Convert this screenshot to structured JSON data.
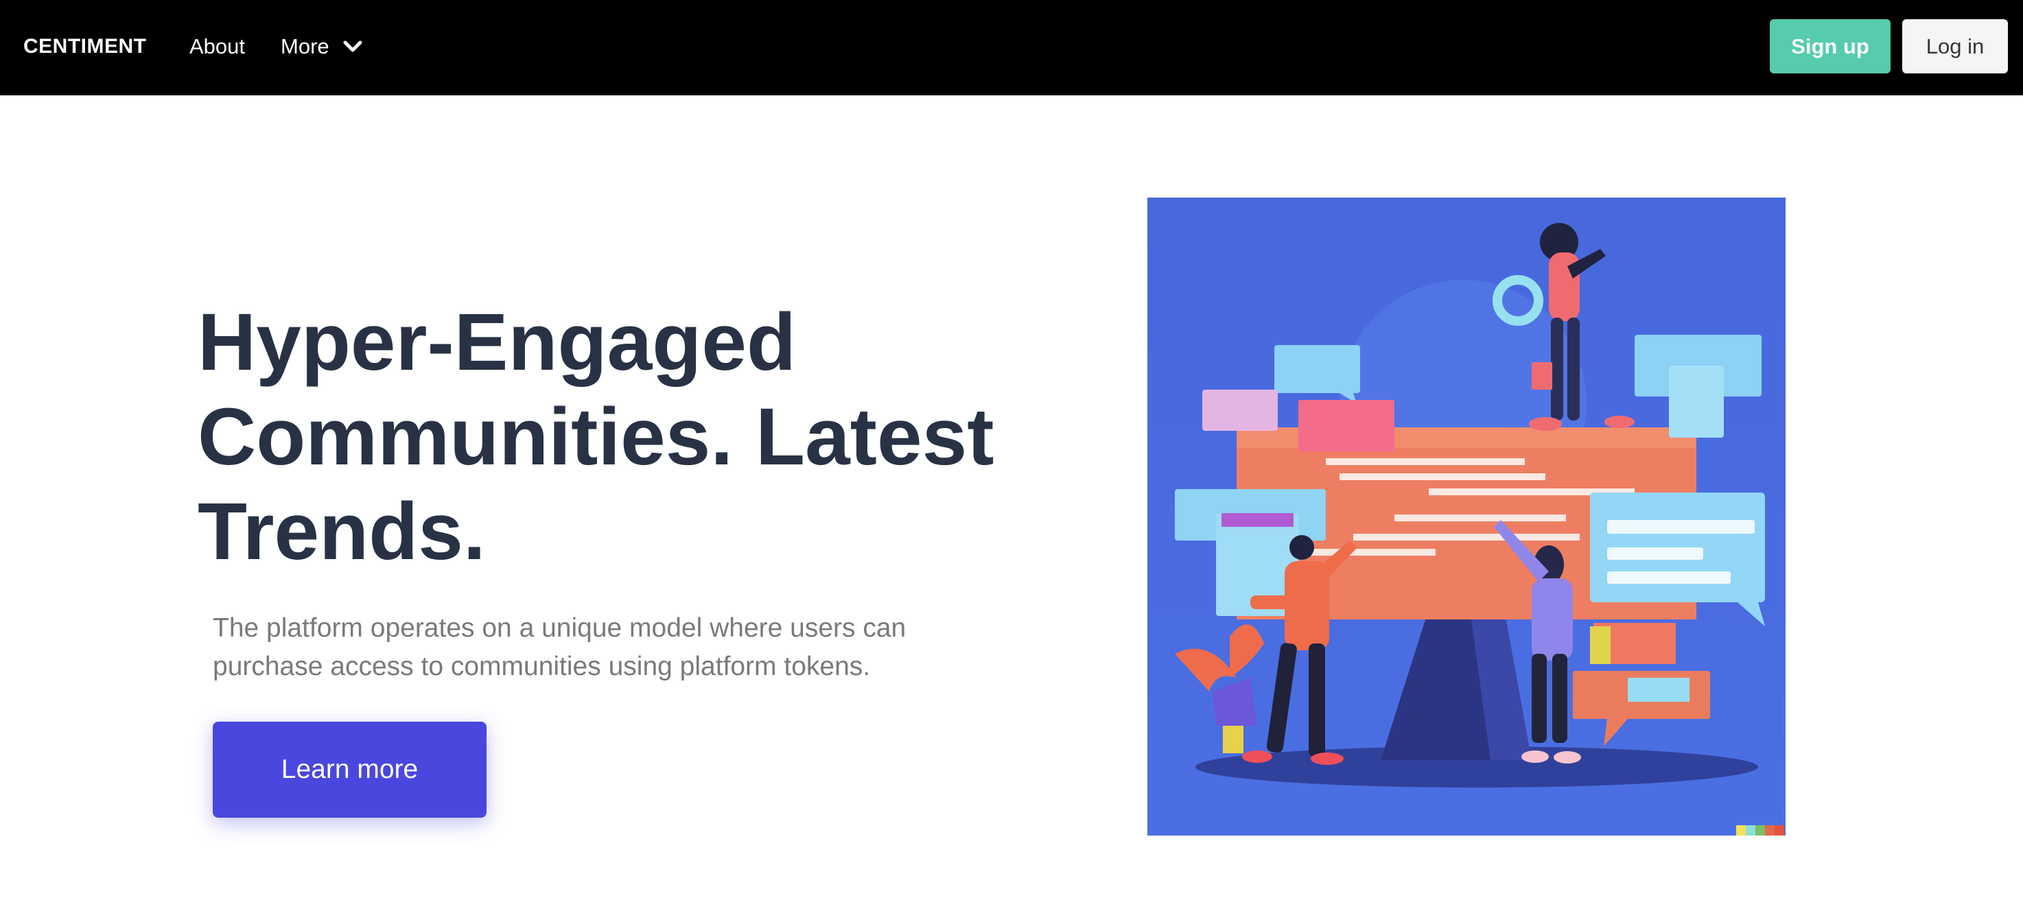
{
  "nav": {
    "brand": "CENTIMENT",
    "about_label": "About",
    "more_label": "More",
    "signup_label": "Sign up",
    "login_label": "Log in"
  },
  "hero": {
    "title": "Hyper-Engaged Communities. Latest Trends.",
    "subtitle": "The platform operates on a unique model where users can purchase access to communities using platform tokens.",
    "cta_label": "Learn more"
  },
  "colors": {
    "nav_bg": "#000000",
    "signup_bg": "#56cbad",
    "login_bg": "#f5f5f5",
    "cta_bg": "#4a47de",
    "title_color": "#283244",
    "subtitle_color": "#7a7a7a",
    "illustration_bg": "#4a6de0"
  },
  "icons": {
    "more_dropdown": "chevron-down-icon",
    "illustration": "community-chat-illustration"
  }
}
